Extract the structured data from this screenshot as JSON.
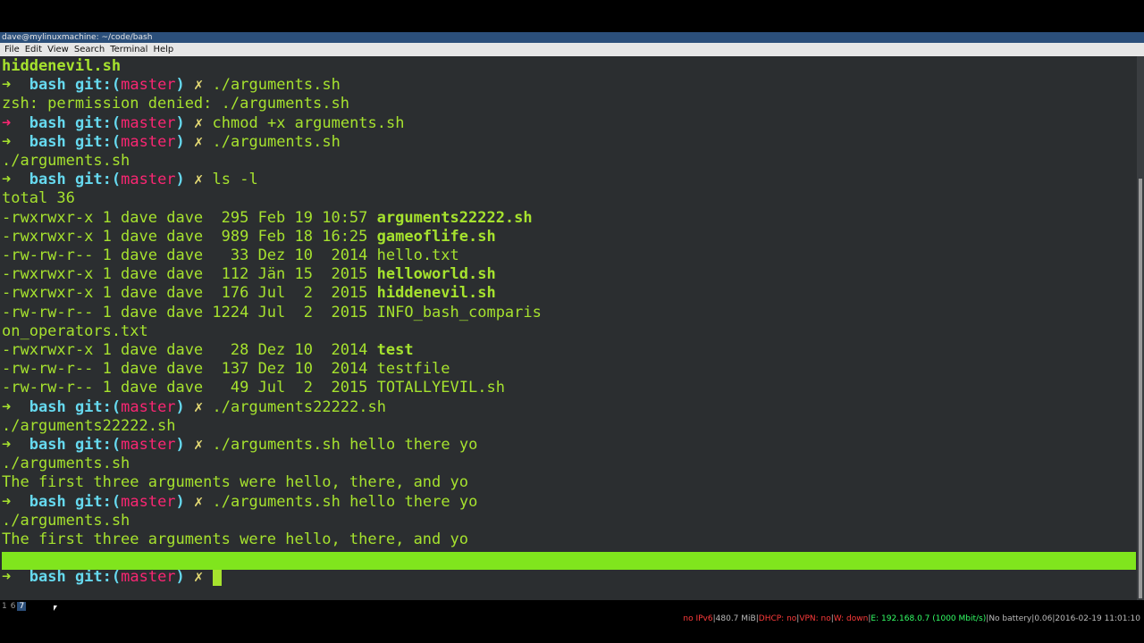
{
  "window": {
    "title": "dave@mylinuxmachine: ~/code/bash"
  },
  "menu": [
    "File",
    "Edit",
    "View",
    "Search",
    "Terminal",
    "Help"
  ],
  "prompt": {
    "arrow": "➜",
    "dir": "bash",
    "git_prefix": "git:(",
    "branch": "master",
    "git_suffix": ")",
    "dirty": "✗"
  },
  "lines": [
    {
      "type": "out",
      "bold": true,
      "text": "hiddenevil.sh"
    },
    {
      "type": "prompt",
      "status": "ok",
      "cmd": "./arguments.sh"
    },
    {
      "type": "out",
      "text": "zsh: permission denied: ./arguments.sh"
    },
    {
      "type": "prompt",
      "status": "err",
      "cmd": "chmod +x arguments.sh"
    },
    {
      "type": "prompt",
      "status": "ok",
      "cmd": "./arguments.sh"
    },
    {
      "type": "out",
      "text": "./arguments.sh"
    },
    {
      "type": "prompt",
      "status": "ok",
      "cmd": "ls -l"
    },
    {
      "type": "out",
      "text": "total 36"
    },
    {
      "type": "file",
      "perm": "-rwxrwxr-x 1 dave dave  295 Feb 19 10:57 ",
      "name": "arguments22222.sh",
      "exec": true
    },
    {
      "type": "file",
      "perm": "-rwxrwxr-x 1 dave dave  989 Feb 18 16:25 ",
      "name": "gameoflife.sh",
      "exec": true
    },
    {
      "type": "file",
      "perm": "-rw-rw-r-- 1 dave dave   33 Dez 10  2014 ",
      "name": "hello.txt",
      "exec": false
    },
    {
      "type": "file",
      "perm": "-rwxrwxr-x 1 dave dave  112 Jän 15  2015 ",
      "name": "helloworld.sh",
      "exec": true
    },
    {
      "type": "file",
      "perm": "-rwxrwxr-x 1 dave dave  176 Jul  2  2015 ",
      "name": "hiddenevil.sh",
      "exec": true
    },
    {
      "type": "file",
      "perm": "-rw-rw-r-- 1 dave dave 1224 Jul  2  2015 ",
      "name": "INFO_bash_comparis",
      "exec": false
    },
    {
      "type": "out",
      "text": "on_operators.txt"
    },
    {
      "type": "file",
      "perm": "-rwxrwxr-x 1 dave dave   28 Dez 10  2014 ",
      "name": "test",
      "exec": true
    },
    {
      "type": "file",
      "perm": "-rw-rw-r-- 1 dave dave  137 Dez 10  2014 ",
      "name": "testfile",
      "exec": false
    },
    {
      "type": "file",
      "perm": "-rw-rw-r-- 1 dave dave   49 Jul  2  2015 ",
      "name": "TOTALLYEVIL.sh",
      "exec": false
    },
    {
      "type": "prompt",
      "status": "ok",
      "cmd": "./arguments22222.sh"
    },
    {
      "type": "out",
      "text": "./arguments22222.sh"
    },
    {
      "type": "prompt",
      "status": "ok",
      "cmd": "./arguments.sh hello there yo"
    },
    {
      "type": "out",
      "text": "./arguments.sh"
    },
    {
      "type": "out",
      "text": "The first three arguments were hello, there, and yo"
    },
    {
      "type": "prompt",
      "status": "ok",
      "cmd": "./arguments.sh hello there yo"
    },
    {
      "type": "out",
      "text": "./arguments.sh"
    },
    {
      "type": "out",
      "text": "The first three arguments were hello, there, and yo"
    }
  ],
  "current_prompt": {
    "status": "ok",
    "cmd": ""
  },
  "statusbar": {
    "workspaces": [
      "1",
      "6",
      "7"
    ],
    "active_workspace": "7",
    "ipv6": "no IPv6",
    "mem": "480.7 MiB",
    "dhcp": "DHCP: no",
    "vpn": "VPN: no",
    "wifi": "W: down",
    "eth": "E: 192.168.0.7 (1000 Mbit/s)",
    "battery": "No battery",
    "load": "0.06",
    "datetime": "2016-02-19 11:01:10"
  }
}
